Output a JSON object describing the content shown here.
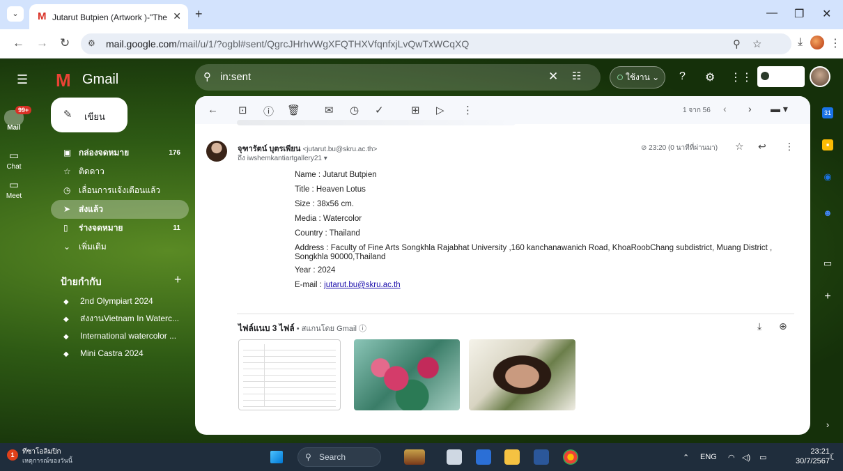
{
  "browser": {
    "tab_title": "Jutarut Butpien (Artwork )-\"The",
    "url_host": "mail.google.com",
    "url_path": "/mail/u/1/?ogbl#sent/QgrcJHrhvWgXFQTHXVfqnfxjLvQwTxWCqXQ"
  },
  "gmail": {
    "app_name": "Gmail",
    "search_value": "in:sent",
    "status_label": "ใช้งาน",
    "compose_label": "เขียน",
    "rail": {
      "mail_label": "Mail",
      "mail_badge": "99+",
      "chat_label": "Chat",
      "meet_label": "Meet"
    },
    "nav": [
      {
        "label": "กล่องจดหมาย",
        "count": "176",
        "icon": "inbox-icon"
      },
      {
        "label": "ติดดาว",
        "count": "",
        "icon": "star-icon"
      },
      {
        "label": "เลื่อนการแจ้งเตือนแล้ว",
        "count": "",
        "icon": "clock-icon"
      },
      {
        "label": "ส่งแล้ว",
        "count": "",
        "icon": "send-icon"
      },
      {
        "label": "ร่างจดหมาย",
        "count": "11",
        "icon": "draft-icon"
      },
      {
        "label": "เพิ่มเติม",
        "count": "",
        "icon": "chevron-down-icon"
      }
    ],
    "labels_heading": "ป้ายกำกับ",
    "labels": [
      "2nd Olympiart 2024",
      "ส่งงานVietnam In Waterc...",
      "International watercolor ...",
      "Mini Castra 2024"
    ]
  },
  "message": {
    "pager": "1 จาก 56",
    "sender_name": "จุฑารัตน์ บุตรเพียน",
    "sender_email": "<jutarut.bu@skru.ac.th>",
    "recipient": "ถึง iwshemkantiartgallery21",
    "time": "23:20 (0 นาทีที่ผ่านมา)",
    "body": {
      "name": "Name : Jutarut Butpien",
      "title": "Title : Heaven Lotus",
      "size": "Size : 38x56 cm.",
      "media": "Media  : Watercolor",
      "country": "Country  : Thailand",
      "address": "Address : Faculty of Fine Arts Songkhla Rajabhat University ,160 kanchanawanich     Road, KhoaRoobChang subdistrict, Muang District , Songkhla 90000,Thailand",
      "year": "Year : 2024",
      "email_prefix": "E-mail : ",
      "email_link": "jutarut.bu@skru.ac.th"
    },
    "attachments_title": "ไฟล์แนบ 3 ไฟล์",
    "attachments_sub": " • สแกนโดย Gmail ⓘ"
  },
  "taskbar": {
    "weather_title": "ทีซาโอลิมปิก",
    "weather_sub": "เหตุการณ์ของวันนี้",
    "weather_badge": "1",
    "search_label": "Search",
    "lang": "ENG",
    "time": "23:21",
    "date": "30/7/2567"
  }
}
